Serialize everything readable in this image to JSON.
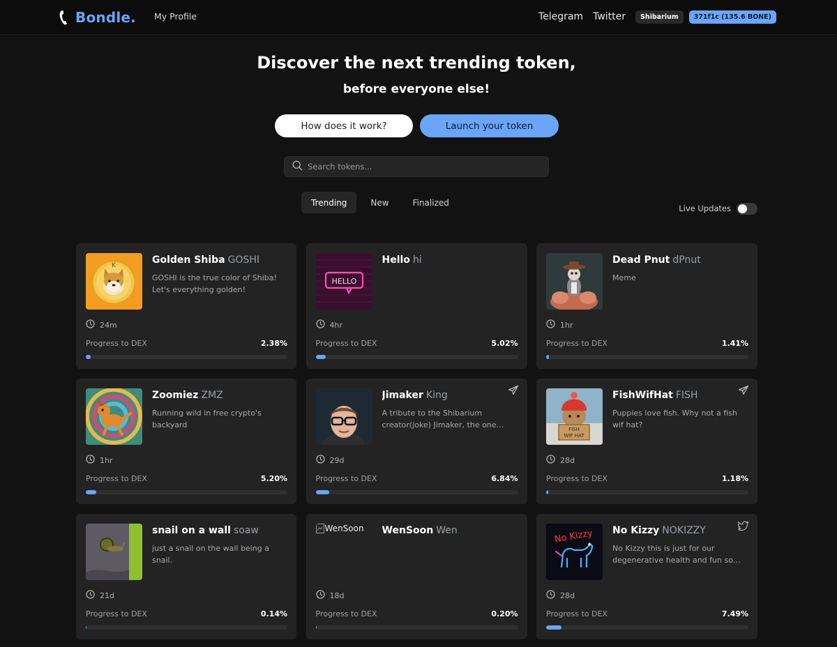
{
  "header": {
    "logo_text": "Bondle.",
    "my_profile": "My Profile",
    "links": [
      "Telegram",
      "Twitter"
    ],
    "network": "Shibarium",
    "wallet": "371f1c (135.6 BONE)"
  },
  "hero": {
    "title": "Discover the next trending token,",
    "subtitle": "before everyone else!",
    "how_button": "How does it work?",
    "launch_button": "Launch your token"
  },
  "search": {
    "placeholder": "Search tokens..."
  },
  "tabs": [
    {
      "label": "Trending",
      "active": true
    },
    {
      "label": "New",
      "active": false
    },
    {
      "label": "Finalized",
      "active": false
    }
  ],
  "live_updates": {
    "label": "Live Updates",
    "enabled": false
  },
  "progress_label": "Progress to DEX",
  "colors": {
    "accent": "#6aa5f8",
    "background": "#121212",
    "card": "#232323"
  },
  "cards": [
    {
      "name": "Golden Shiba",
      "ticker": "GOSHI",
      "description": "GOSHI is the true color of Shiba! Let's everything golden!",
      "time": "24m",
      "progress": "2.38%",
      "progress_value": 2.38,
      "social": "",
      "image": "golden-shiba-image"
    },
    {
      "name": "Hello",
      "ticker": "hi",
      "description": "",
      "time": "4hr",
      "progress": "5.02%",
      "progress_value": 5.02,
      "social": "",
      "image": "hello-neon-image"
    },
    {
      "name": "Dead Pnut",
      "ticker": "dPnut",
      "description": "Meme",
      "time": "1hr",
      "progress": "1.41%",
      "progress_value": 1.41,
      "social": "",
      "image": "dead-pnut-image"
    },
    {
      "name": "Zoomiez",
      "ticker": "ZMZ",
      "description": "Running wild in free crypto's backyard",
      "time": "1hr",
      "progress": "5.20%",
      "progress_value": 5.2,
      "social": "",
      "image": "zoomiez-dog-image"
    },
    {
      "name": "Jimaker",
      "ticker": "King",
      "description": "A tribute to the Shibarium creator(joke) Jimaker, the one…",
      "time": "29d",
      "progress": "6.84%",
      "progress_value": 6.84,
      "social": "telegram-icon",
      "image": "jimaker-image"
    },
    {
      "name": "FishWifHat",
      "ticker": "FISH",
      "description": "Puppies love fish. Why not a fish wif hat?",
      "time": "28d",
      "progress": "1.18%",
      "progress_value": 1.18,
      "social": "telegram-icon",
      "image": "fishwifhat-image"
    },
    {
      "name": "snail on a wall",
      "ticker": "soaw",
      "description": "just a snail on the wall being a snail.",
      "time": "21d",
      "progress": "0.14%",
      "progress_value": 0.14,
      "social": "",
      "image": "snail-image"
    },
    {
      "name": "WenSoon",
      "ticker": "Wen",
      "description": "",
      "time": "18d",
      "progress": "0.20%",
      "progress_value": 0.2,
      "social": "",
      "image": "broken-image",
      "image_alt": "WenSoon"
    },
    {
      "name": "No Kizzy",
      "ticker": "NOKIZZY",
      "description": "No Kizzy this is just for our degenerative health and fun so…",
      "time": "28d",
      "progress": "7.49%",
      "progress_value": 7.49,
      "social": "twitter-icon",
      "image": "no-kizzy-image"
    }
  ]
}
